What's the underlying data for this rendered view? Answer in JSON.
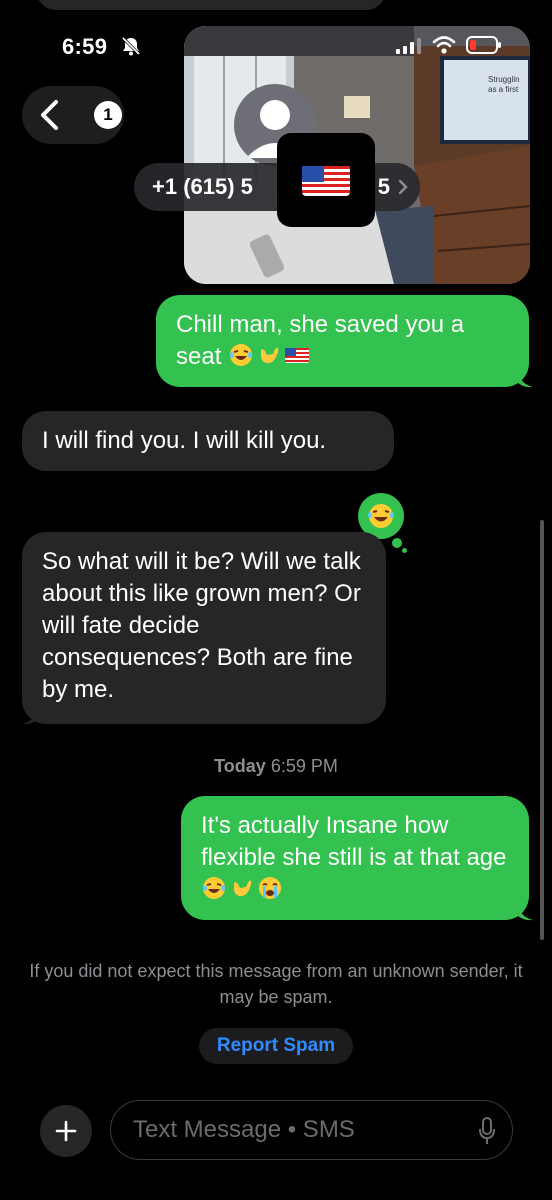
{
  "status_bar": {
    "time": "6:59",
    "icons": [
      "bell-slash-icon",
      "signal-icon",
      "wifi-icon",
      "battery-low-icon"
    ]
  },
  "header": {
    "back_badge": "1",
    "contact_number": "+1 (615) 5",
    "contact_suffix": "5",
    "flag_emoji": "us-flag-icon"
  },
  "video_overlay": {
    "screen_text_1": "Strugglin",
    "screen_text_2": "as a first"
  },
  "messages": [
    {
      "direction": "sent",
      "text": "Chill man, she saved you a seat",
      "emojis": [
        "laughing-crying-icon",
        "call-me-hand-icon",
        "us-flag-icon"
      ]
    },
    {
      "direction": "received",
      "text": "I will find you.  I will kill you."
    },
    {
      "direction": "received",
      "text": "So what will it be? Will we talk about this like grown men? Or will fate decide consequences? Both are fine by me.",
      "reaction": "laughing-crying-icon"
    },
    {
      "direction": "sent",
      "text": "It's actually Insane how flexible she still is at that age",
      "emojis": [
        "laughing-crying-icon",
        "call-me-hand-icon",
        "loudly-crying-icon"
      ]
    }
  ],
  "timestamp": {
    "day": "Today",
    "time": "6:59 PM"
  },
  "spam_notice": "If you did not expect this message from an unknown sender, it may be spam.",
  "report_spam_label": "Report Spam",
  "input": {
    "placeholder": "Text Message • SMS"
  },
  "colors": {
    "sent_bubble": "#33c24f",
    "received_bubble": "#262628",
    "link_blue": "#2e8cff",
    "battery_red": "#ff3b30"
  }
}
